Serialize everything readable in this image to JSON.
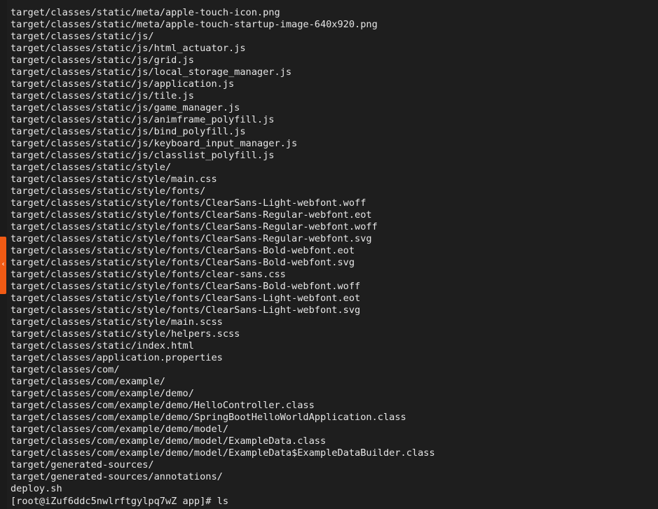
{
  "terminal": {
    "output_lines": [
      "target/classes/static/meta/apple-touch-icon.png",
      "target/classes/static/meta/apple-touch-startup-image-640x920.png",
      "target/classes/static/js/",
      "target/classes/static/js/html_actuator.js",
      "target/classes/static/js/grid.js",
      "target/classes/static/js/local_storage_manager.js",
      "target/classes/static/js/application.js",
      "target/classes/static/js/tile.js",
      "target/classes/static/js/game_manager.js",
      "target/classes/static/js/animframe_polyfill.js",
      "target/classes/static/js/bind_polyfill.js",
      "target/classes/static/js/keyboard_input_manager.js",
      "target/classes/static/js/classlist_polyfill.js",
      "target/classes/static/style/",
      "target/classes/static/style/main.css",
      "target/classes/static/style/fonts/",
      "target/classes/static/style/fonts/ClearSans-Light-webfont.woff",
      "target/classes/static/style/fonts/ClearSans-Regular-webfont.eot",
      "target/classes/static/style/fonts/ClearSans-Regular-webfont.woff",
      "target/classes/static/style/fonts/ClearSans-Regular-webfont.svg",
      "target/classes/static/style/fonts/ClearSans-Bold-webfont.eot",
      "target/classes/static/style/fonts/ClearSans-Bold-webfont.svg",
      "target/classes/static/style/fonts/clear-sans.css",
      "target/classes/static/style/fonts/ClearSans-Bold-webfont.woff",
      "target/classes/static/style/fonts/ClearSans-Light-webfont.eot",
      "target/classes/static/style/fonts/ClearSans-Light-webfont.svg",
      "target/classes/static/style/main.scss",
      "target/classes/static/style/helpers.scss",
      "target/classes/static/index.html",
      "target/classes/application.properties",
      "target/classes/com/",
      "target/classes/com/example/",
      "target/classes/com/example/demo/",
      "target/classes/com/example/demo/HelloController.class",
      "target/classes/com/example/demo/SpringBootHelloWorldApplication.class",
      "target/classes/com/example/demo/model/",
      "target/classes/com/example/demo/model/ExampleData.class",
      "target/classes/com/example/demo/model/ExampleData$ExampleDataBuilder.class",
      "target/generated-sources/",
      "target/generated-sources/annotations/",
      "deploy.sh"
    ],
    "prompt": "[root@iZuf6ddc5nwlrftgylpq7wZ app]# ",
    "command": "ls"
  },
  "side_tab": {
    "icon": "chevron-left-icon",
    "glyph": "‹",
    "color": "#f05a14"
  },
  "colors": {
    "background": "#1e1e1e",
    "text": "#e6e6e6"
  }
}
